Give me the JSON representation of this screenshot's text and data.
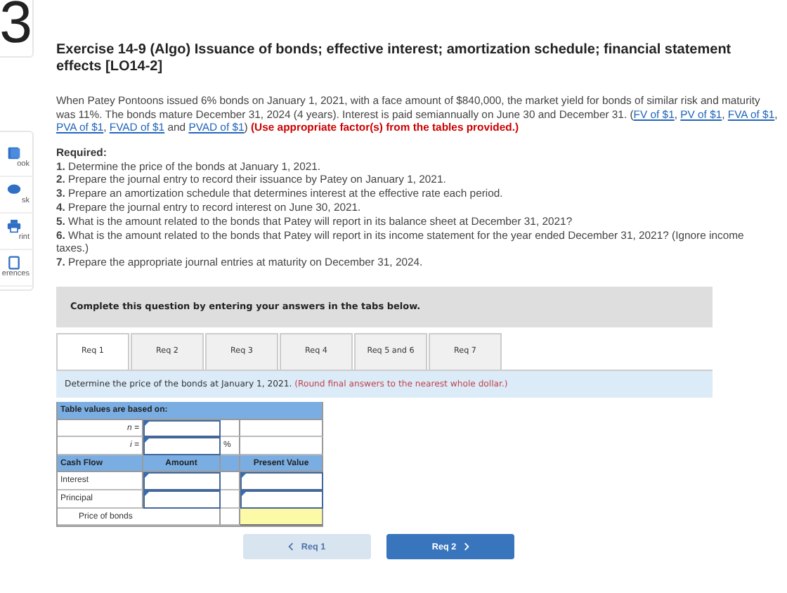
{
  "sidebar": {
    "question_number": "3",
    "items": [
      {
        "kind": "book",
        "label": "ook"
      },
      {
        "kind": "ask",
        "label": "sk"
      },
      {
        "kind": "print",
        "label": "rint"
      },
      {
        "kind": "references",
        "label": "erences"
      }
    ]
  },
  "title": "Exercise 14-9 (Algo) Issuance of bonds; effective interest; amortization schedule; financial statement effects [LO14-2]",
  "problem": [
    {
      "kind": "text",
      "text": "When Patey Pontoons issued 6% bonds on January 1, 2021, with a face amount of $840,000, the market yield for bonds of similar risk and maturity was 11%. The bonds mature December 31, 2024 (4 years). Interest is paid semiannually on June 30 and December 31. ("
    },
    {
      "kind": "link",
      "text": "FV of $1"
    },
    {
      "kind": "text",
      "text": ", "
    },
    {
      "kind": "link",
      "text": "PV of $1"
    },
    {
      "kind": "text",
      "text": ", "
    },
    {
      "kind": "link",
      "text": "FVA of $1"
    },
    {
      "kind": "text",
      "text": ", "
    },
    {
      "kind": "link",
      "text": "PVA of $1"
    },
    {
      "kind": "text",
      "text": ", "
    },
    {
      "kind": "link",
      "text": "FVAD of $1"
    },
    {
      "kind": "text",
      "text": " and "
    },
    {
      "kind": "link",
      "text": "PVAD of $1"
    },
    {
      "kind": "text",
      "text": ") "
    },
    {
      "kind": "note",
      "text": "(Use appropriate factor(s) from the tables provided.)"
    }
  ],
  "required": {
    "heading": "Required:",
    "items": [
      "**1.** Determine the price of the bonds at January 1, 2021.",
      "**2.** Prepare the journal entry to record their issuance by Patey on January 1, 2021.",
      "**3.** Prepare an amortization schedule that determines interest at the effective rate each period.",
      "**4.** Prepare the journal entry to record interest on June 30, 2021.",
      "**5.** What is the amount related to the bonds that Patey will report in its balance sheet at December 31, 2021?",
      "**6.** What is the amount related to the bonds that Patey will report in its income statement for the year ended December 31, 2021? (Ignore income taxes.)",
      "**7.** Prepare the appropriate journal entries at maturity on December 31, 2024."
    ]
  },
  "banner": "Complete this question by entering your answers in the tabs below.",
  "tabs": [
    {
      "label": "Req 1",
      "selected": true
    },
    {
      "label": "Req 2",
      "selected": false
    },
    {
      "label": "Req 3",
      "selected": false
    },
    {
      "label": "Req 4",
      "selected": false
    },
    {
      "label": "Req 5 and 6",
      "selected": false
    },
    {
      "label": "Req 7",
      "selected": false
    }
  ],
  "instruction": {
    "text": "Determine the price of the bonds at January 1, 2021.",
    "note": "(Round final answers to the nearest whole dollar.)"
  },
  "answer_table": {
    "header": "Table values are based on:",
    "n_label": "n =",
    "i_label": "i =",
    "i_unit": "%",
    "columns": [
      "Cash Flow",
      "Amount",
      "Present Value"
    ],
    "rows": [
      {
        "label": "Interest"
      },
      {
        "label": "Principal"
      }
    ],
    "total_label": "Price of bonds"
  },
  "nav_buttons": [
    {
      "label": "Req 1",
      "kind": "prev",
      "disabled": true
    },
    {
      "label": "Req 2",
      "kind": "next",
      "disabled": false
    }
  ]
}
